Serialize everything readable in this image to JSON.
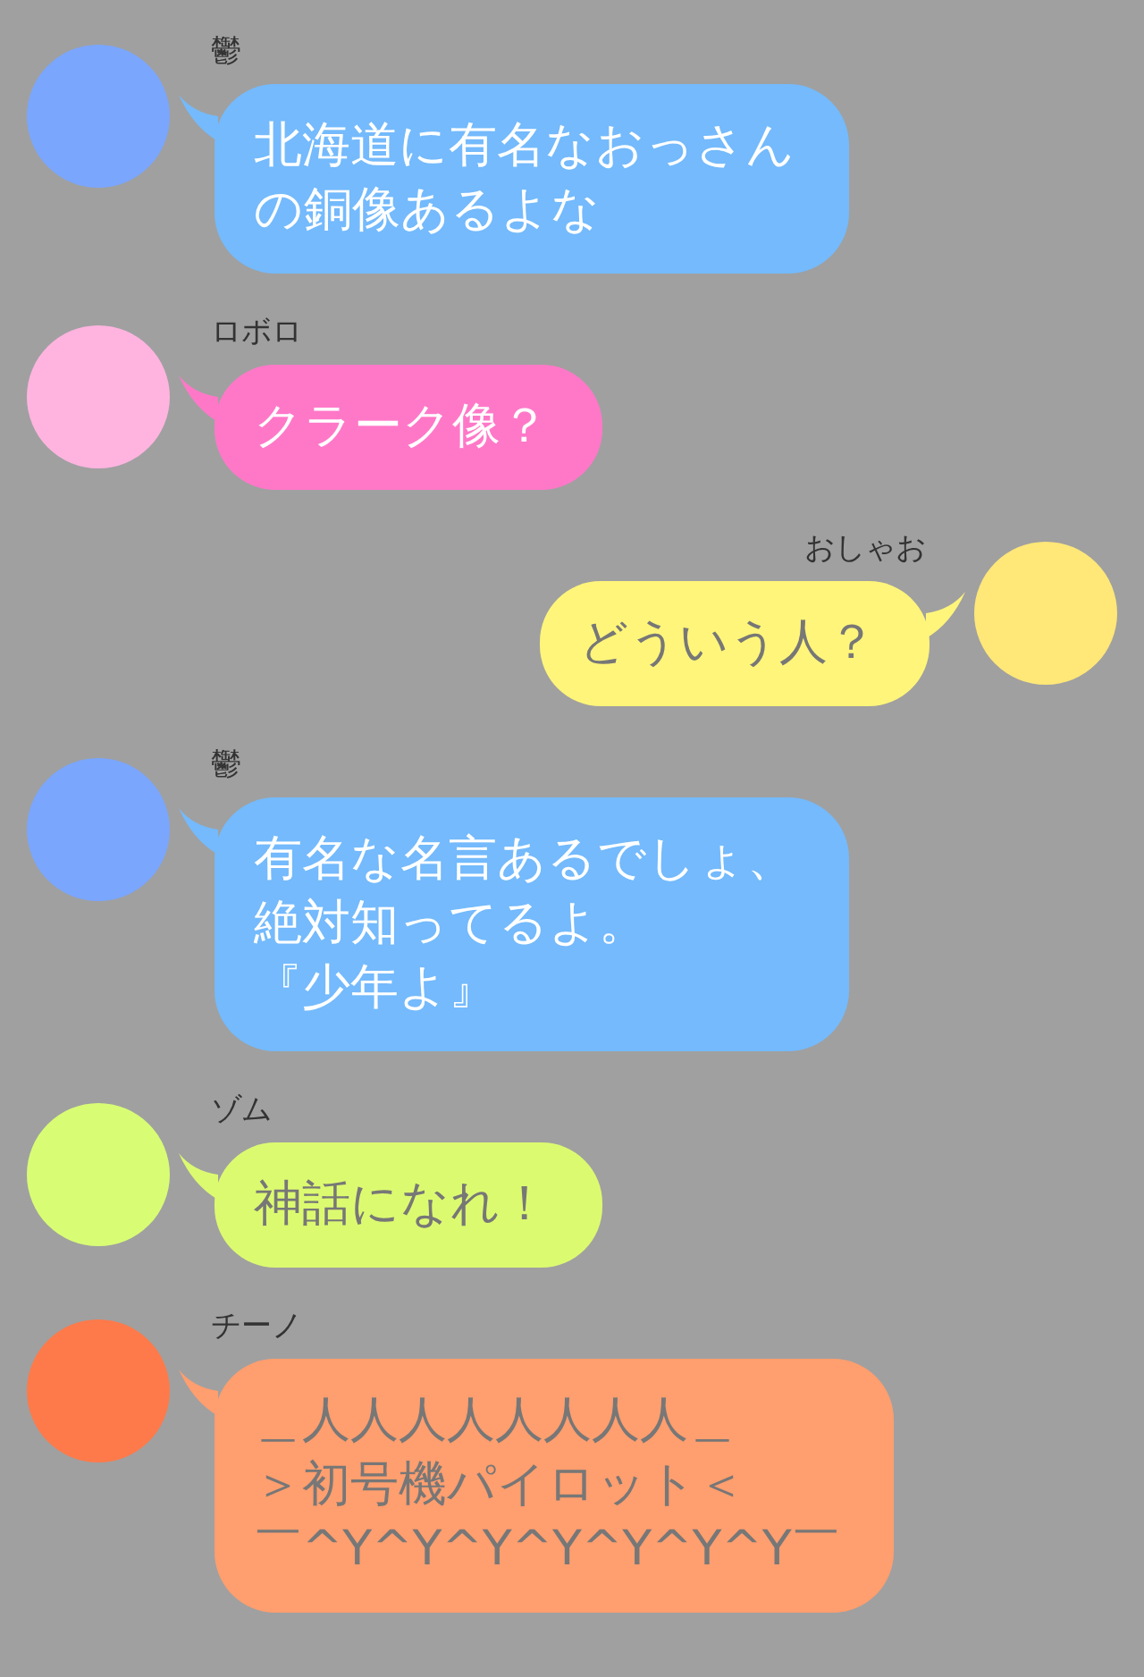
{
  "messages": [
    {
      "kind": "left",
      "name": "鬱",
      "avatar": {
        "color": "#7aa6fd"
      },
      "bubble": {
        "color": "#74bafc",
        "light_text": true,
        "lines": [
          "北海道に有名なおっさん",
          "の銅像あるよな"
        ]
      }
    },
    {
      "kind": "left",
      "name": "ロボロ",
      "avatar": {
        "color": "#ffb4e0"
      },
      "bubble": {
        "color": "#ff78c8",
        "light_text": true,
        "lines": [
          "クラーク像？"
        ]
      }
    },
    {
      "kind": "right",
      "name": "おしゃお",
      "avatar": {
        "color": "#ffe778"
      },
      "bubble": {
        "color": "#fff57a",
        "light_text": false,
        "lines": [
          "どういう人？"
        ]
      }
    },
    {
      "kind": "left",
      "name": "鬱",
      "avatar": {
        "color": "#7aa6fd"
      },
      "bubble": {
        "color": "#74bafc",
        "light_text": true,
        "lines": [
          "有名な名言あるでしょ、",
          "絶対知ってるよ。",
          "『少年よ』"
        ]
      }
    },
    {
      "kind": "left",
      "name": "ゾム",
      "avatar": {
        "color": "#d8fd75"
      },
      "bubble": {
        "color": "#dcfa70",
        "light_text": false,
        "lines": [
          "神話になれ！"
        ]
      }
    },
    {
      "kind": "left",
      "name": "チーノ",
      "avatar": {
        "color": "#ff7a4a"
      },
      "bubble": {
        "color": "#ff9e6e",
        "light_text": false,
        "lines": [
          "＿人人人人人人人人＿",
          "＞初号機パイロット＜",
          "￣^Y^Y^Y^Y^Y^Y^Y￣"
        ]
      }
    }
  ]
}
